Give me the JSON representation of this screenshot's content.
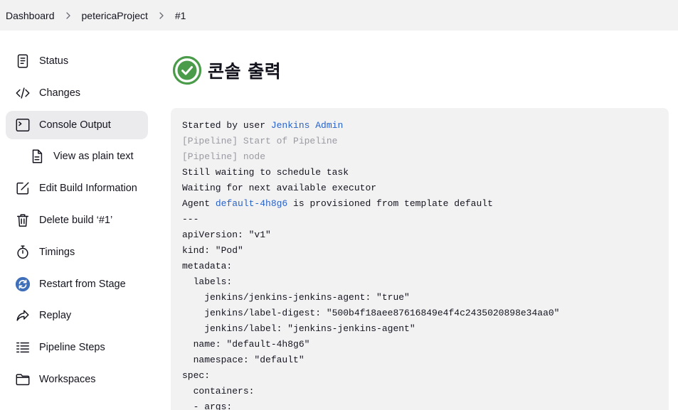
{
  "breadcrumb": {
    "items": [
      "Dashboard",
      "petericaProject",
      "#1"
    ]
  },
  "sidebar": {
    "items": [
      {
        "label": "Status",
        "icon": "document-icon"
      },
      {
        "label": "Changes",
        "icon": "code-icon"
      },
      {
        "label": "Console Output",
        "icon": "terminal-icon",
        "active": true
      },
      {
        "label": "View as plain text",
        "icon": "file-text-icon"
      },
      {
        "label": "Edit Build Information",
        "icon": "edit-icon"
      },
      {
        "label": "Delete build ‘#1’",
        "icon": "trash-icon"
      },
      {
        "label": "Timings",
        "icon": "stopwatch-icon"
      },
      {
        "label": "Restart from Stage",
        "icon": "restart-icon"
      },
      {
        "label": "Replay",
        "icon": "replay-icon"
      },
      {
        "label": "Pipeline Steps",
        "icon": "list-icon"
      },
      {
        "label": "Workspaces",
        "icon": "folder-icon"
      }
    ]
  },
  "main": {
    "title": "콘솔 출력",
    "status_color": "#4a9b4a"
  },
  "console": {
    "line1_prefix": "Started by user ",
    "line1_link": "Jenkins Admin",
    "line2": "[Pipeline] Start of Pipeline",
    "line3": "[Pipeline] node",
    "line4": "Still waiting to schedule task",
    "line5": "Waiting for next available executor",
    "line6_prefix": "Agent ",
    "line6_link": "default-4h8g6",
    "line6_suffix": " is provisioned from template default",
    "line7": "---",
    "line8": "apiVersion: \"v1\"",
    "line9": "kind: \"Pod\"",
    "line10": "metadata:",
    "line11": "  labels:",
    "line12": "    jenkins/jenkins-jenkins-agent: \"true\"",
    "line13": "    jenkins/label-digest: \"500b4f18aee87616849e4f4c2435020898e34aa0\"",
    "line14": "    jenkins/label: \"jenkins-jenkins-agent\"",
    "line15": "  name: \"default-4h8g6\"",
    "line16": "  namespace: \"default\"",
    "line17": "spec:",
    "line18": "  containers:",
    "line19": "  - args:"
  }
}
